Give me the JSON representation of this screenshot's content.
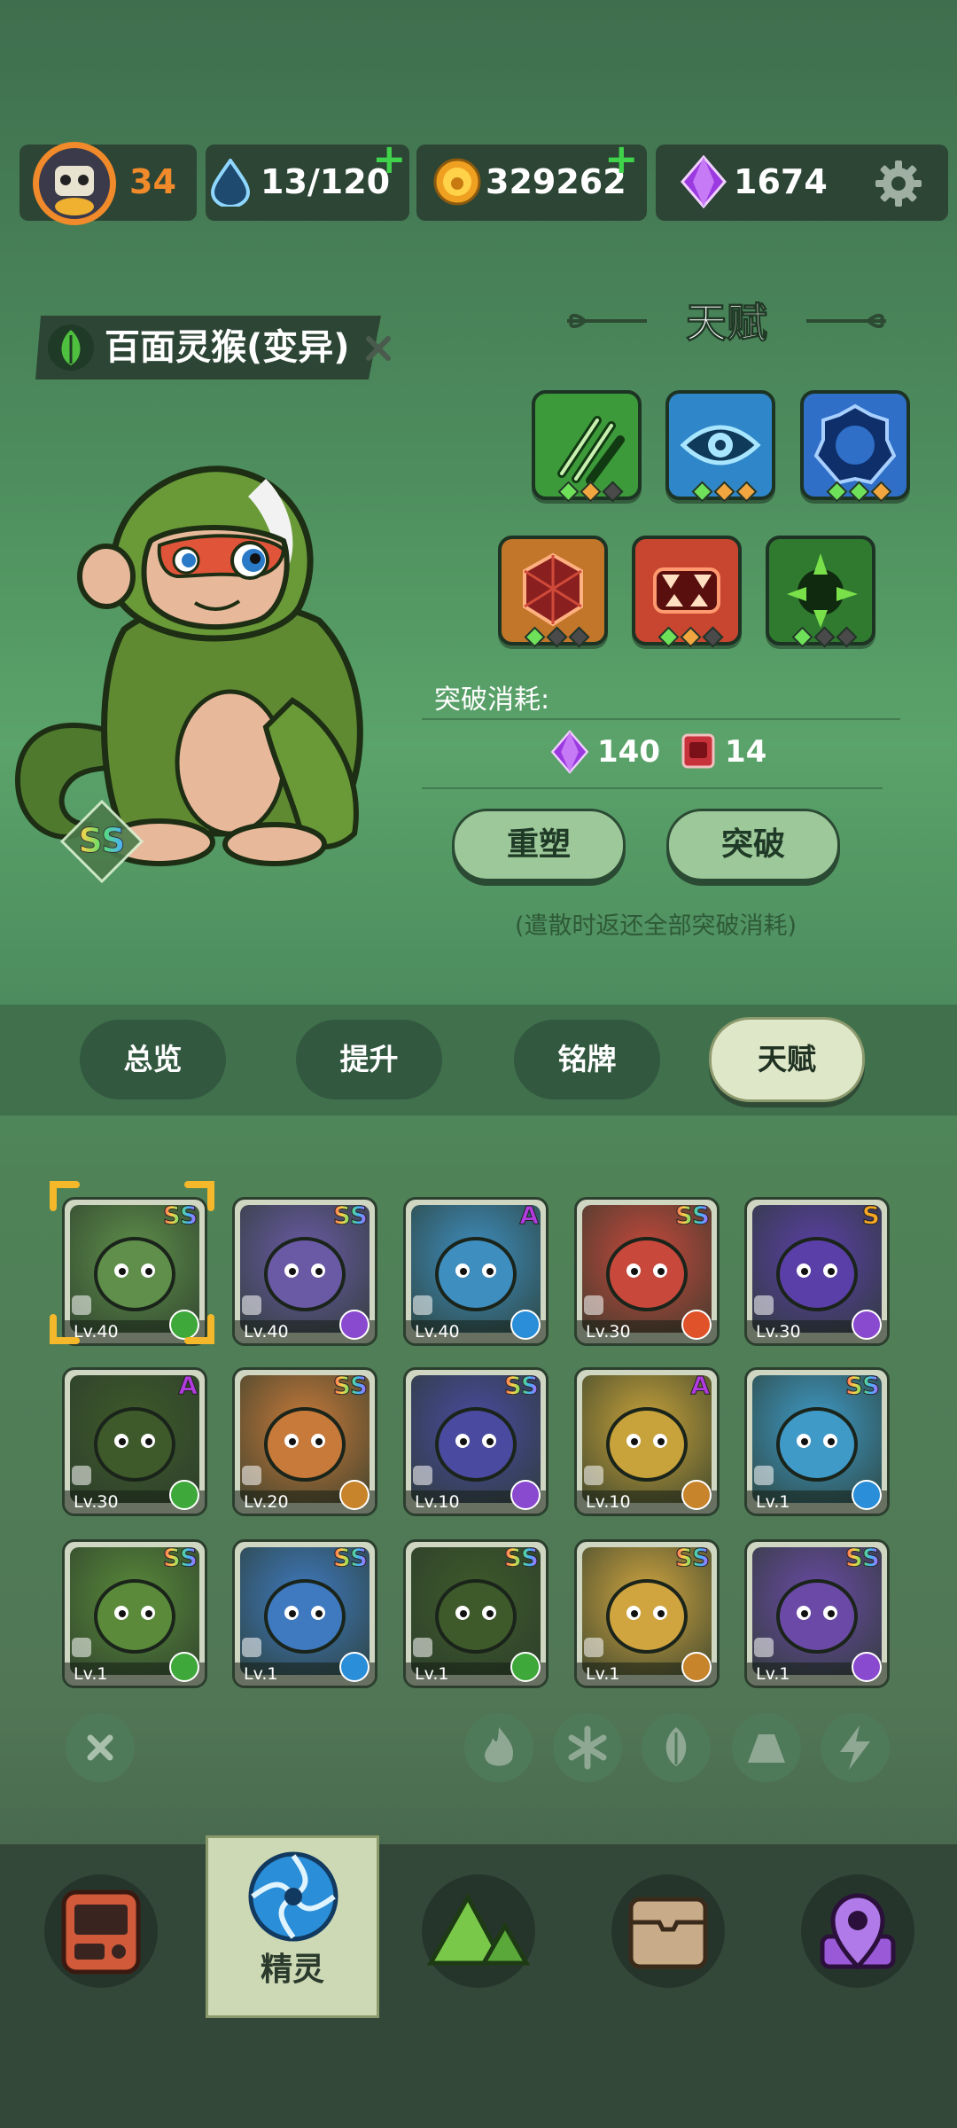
{
  "top_bar": {
    "level": "34",
    "stamina": "13/120",
    "coins": "329262",
    "gems": "1674"
  },
  "creature": {
    "name": "百面灵猴(变异)",
    "rank": "SS"
  },
  "talent_panel": {
    "title": "天赋",
    "breakthrough_label": "突破消耗:",
    "cost_gems": "140",
    "cost_books": "14",
    "reshape_button": "重塑",
    "breakthrough_button": "突破",
    "note": "(遣散时返还全部突破消耗)"
  },
  "talents": [
    {
      "icon": "claw-slash-icon",
      "color": "#3c9a3a",
      "levels": [
        "#6fe05a",
        "#f2a640",
        "#4a4a4a"
      ]
    },
    {
      "icon": "eye-icon",
      "color": "#2f86c8",
      "levels": [
        "#6fe05a",
        "#f2a640",
        "#f2a640"
      ]
    },
    {
      "icon": "gear-ring-icon",
      "color": "#2f6fc8",
      "levels": [
        "#6fe05a",
        "#6fe05a",
        "#f2a640"
      ]
    },
    {
      "icon": "shield-hex-icon",
      "color": "#c2762a",
      "levels": [
        "#6fe05a",
        "#4a4a4a",
        "#4a4a4a"
      ]
    },
    {
      "icon": "fang-mouth-icon",
      "color": "#c8452f",
      "levels": [
        "#6fe05a",
        "#f2a640",
        "#4a4a4a"
      ]
    },
    {
      "icon": "thorn-burst-icon",
      "color": "#2f7a2f",
      "levels": [
        "#6fe05a",
        "#4a4a4a",
        "#4a4a4a"
      ]
    }
  ],
  "tabs": [
    "总览",
    "提升",
    "铭牌",
    "天赋"
  ],
  "active_tab": "天赋",
  "roster": [
    {
      "rank": "SS",
      "level": "Lv.40",
      "element": "grass",
      "bg": "#5f8f4a",
      "selected": true
    },
    {
      "rank": "SS",
      "level": "Lv.40",
      "element": "electric",
      "bg": "#6a5aa6"
    },
    {
      "rank": "A",
      "level": "Lv.40",
      "element": "ice",
      "bg": "#3f8ec0"
    },
    {
      "rank": "SS",
      "level": "Lv.30",
      "element": "fire",
      "bg": "#c8483c"
    },
    {
      "rank": "S",
      "level": "Lv.30",
      "element": "electric",
      "bg": "#5b3fa8"
    },
    {
      "rank": "A",
      "level": "Lv.30",
      "element": "grass",
      "bg": "#3f5a2a"
    },
    {
      "rank": "SS",
      "level": "Lv.20",
      "element": "earth",
      "bg": "#c87a3a"
    },
    {
      "rank": "SS",
      "level": "Lv.10",
      "element": "electric",
      "bg": "#4a4aa0"
    },
    {
      "rank": "A",
      "level": "Lv.10",
      "element": "earth",
      "bg": "#c8a23a"
    },
    {
      "rank": "SS",
      "level": "Lv.1",
      "element": "ice",
      "bg": "#3f9ac8"
    },
    {
      "rank": "SS",
      "level": "Lv.1",
      "element": "grass",
      "bg": "#5a8a3a"
    },
    {
      "rank": "SS",
      "level": "Lv.1",
      "element": "ice",
      "bg": "#3f7ac0"
    },
    {
      "rank": "SS",
      "level": "Lv.1",
      "element": "grass",
      "bg": "#3f5a2a"
    },
    {
      "rank": "SS",
      "level": "Lv.1",
      "element": "earth",
      "bg": "#d0a540"
    },
    {
      "rank": "SS",
      "level": "Lv.1",
      "element": "electric",
      "bg": "#6a4aa6"
    }
  ],
  "filters": [
    "clear-filter-icon",
    "fire-icon",
    "ice-icon",
    "grass-icon",
    "earth-icon",
    "electric-icon"
  ],
  "bottom_nav": {
    "active_label": "精灵",
    "items": [
      "console-icon",
      "spirit-orb-icon",
      "mountain-icon",
      "chest-icon",
      "map-pin-icon"
    ]
  },
  "colors": {
    "rank_SS": "rainbow",
    "rank_S": "#f5a623",
    "rank_A": "#b23be0",
    "grass": "#3ea83a",
    "electric": "#8a4ad0",
    "ice": "#2a8ed8",
    "fire": "#e0522a",
    "earth": "#c8842a"
  }
}
